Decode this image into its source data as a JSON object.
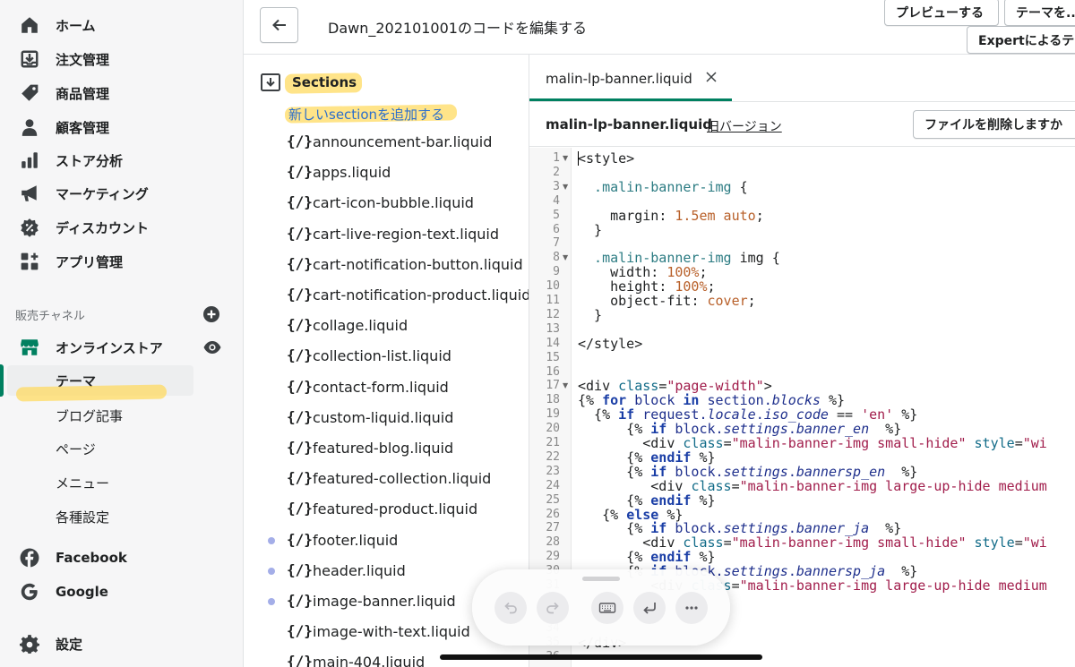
{
  "nav": {
    "items": [
      {
        "label": "ホーム",
        "icon": "home-icon"
      },
      {
        "label": "注文管理",
        "icon": "orders-icon"
      },
      {
        "label": "商品管理",
        "icon": "tag-icon"
      },
      {
        "label": "顧客管理",
        "icon": "person-icon"
      },
      {
        "label": "ストア分析",
        "icon": "bar-chart-icon"
      },
      {
        "label": "マーケティング",
        "icon": "megaphone-icon"
      },
      {
        "label": "ディスカウント",
        "icon": "discount-icon"
      },
      {
        "label": "アプリ管理",
        "icon": "apps-icon"
      }
    ],
    "channels_heading": "販売チャネル",
    "online_store": {
      "label": "オンラインストア",
      "icon": "store-icon"
    },
    "online_store_sub": [
      {
        "label": "テーマ",
        "active": true
      },
      {
        "label": "ブログ記事"
      },
      {
        "label": "ページ"
      },
      {
        "label": "メニュー"
      },
      {
        "label": "各種設定"
      }
    ],
    "apps": [
      {
        "label": "Facebook",
        "icon": "facebook-icon"
      },
      {
        "label": "Google",
        "icon": "google-icon"
      }
    ],
    "settings_label": "設定"
  },
  "topbar": {
    "title": "Dawn_202101001のコードを編集する",
    "preview_label": "プレビューする",
    "theme_label": "テーマを...",
    "expert_label": "Expertによるテ..."
  },
  "tree": {
    "folder_label": "Sections",
    "add_new_label": "新しいsectionを追加する",
    "code_glyph": "{/}",
    "files": [
      {
        "name": "announcement-bar.liquid",
        "modified": false
      },
      {
        "name": "apps.liquid",
        "modified": false
      },
      {
        "name": "cart-icon-bubble.liquid",
        "modified": false
      },
      {
        "name": "cart-live-region-text.liquid",
        "modified": false
      },
      {
        "name": "cart-notification-button.liquid",
        "modified": false
      },
      {
        "name": "cart-notification-product.liquid",
        "modified": false
      },
      {
        "name": "collage.liquid",
        "modified": false
      },
      {
        "name": "collection-list.liquid",
        "modified": false
      },
      {
        "name": "contact-form.liquid",
        "modified": false
      },
      {
        "name": "custom-liquid.liquid",
        "modified": false
      },
      {
        "name": "featured-blog.liquid",
        "modified": false
      },
      {
        "name": "featured-collection.liquid",
        "modified": false
      },
      {
        "name": "featured-product.liquid",
        "modified": false
      },
      {
        "name": "footer.liquid",
        "modified": true
      },
      {
        "name": "header.liquid",
        "modified": true
      },
      {
        "name": "image-banner.liquid",
        "modified": true
      },
      {
        "name": "image-with-text.liquid",
        "modified": false
      },
      {
        "name": "main-404.liquid",
        "modified": false
      }
    ]
  },
  "editor": {
    "tab_label": "malin-lp-banner.liquid",
    "file_title": "malin-lp-banner.liquid",
    "old_version_label": "旧バージョン",
    "delete_label": "ファイルを削除しますか",
    "line_numbers": [
      "1",
      "2",
      "3",
      "4",
      "5",
      "6",
      "7",
      "8",
      "9",
      "10",
      "11",
      "12",
      "13",
      "14",
      "15",
      "16",
      "17",
      "18",
      "19",
      "20",
      "21",
      "22",
      "23",
      "24",
      "25",
      "26",
      "27",
      "28",
      "29",
      "30",
      "31",
      "32",
      "33",
      "34",
      "35",
      "36"
    ],
    "fold_lines": [
      "1",
      "3",
      "8",
      "17"
    ],
    "lines": [
      [
        {
          "t": "<style>",
          "c": "t"
        }
      ],
      [],
      [
        {
          "t": "  .malin-banner-img",
          "c": "s"
        },
        {
          "t": " {",
          "c": "p"
        }
      ],
      [],
      [
        {
          "t": "    margin",
          "c": "p"
        },
        {
          "t": ": ",
          "c": "p"
        },
        {
          "t": "1.5em auto",
          "c": "v"
        },
        {
          "t": ";",
          "c": "p"
        }
      ],
      [
        {
          "t": "  }",
          "c": "p"
        }
      ],
      [],
      [
        {
          "t": "  .malin-banner-img",
          "c": "s"
        },
        {
          "t": " img {",
          "c": "p"
        }
      ],
      [
        {
          "t": "    width",
          "c": "p"
        },
        {
          "t": ": ",
          "c": "p"
        },
        {
          "t": "100%",
          "c": "v"
        },
        {
          "t": ";",
          "c": "p"
        }
      ],
      [
        {
          "t": "    height",
          "c": "p"
        },
        {
          "t": ": ",
          "c": "p"
        },
        {
          "t": "100%",
          "c": "v"
        },
        {
          "t": ";",
          "c": "p"
        }
      ],
      [
        {
          "t": "    object-fit",
          "c": "p"
        },
        {
          "t": ": ",
          "c": "p"
        },
        {
          "t": "cover",
          "c": "v"
        },
        {
          "t": ";",
          "c": "p"
        }
      ],
      [
        {
          "t": "  }",
          "c": "p"
        }
      ],
      [],
      [
        {
          "t": "</style>",
          "c": "t"
        }
      ],
      [],
      [],
      [
        {
          "t": "<div ",
          "c": "t"
        },
        {
          "t": "class",
          "c": "a"
        },
        {
          "t": "=",
          "c": "p"
        },
        {
          "t": "\"page-width\"",
          "c": "str"
        },
        {
          "t": ">",
          "c": "t"
        }
      ],
      [
        {
          "t": "{% ",
          "c": "lq"
        },
        {
          "t": "for",
          "c": "kw"
        },
        {
          "t": " block ",
          "c": "vr"
        },
        {
          "t": "in",
          "c": "kw"
        },
        {
          "t": " section.",
          "c": "vr"
        },
        {
          "t": "blocks",
          "c": "it"
        },
        {
          "t": " %}",
          "c": "lq"
        }
      ],
      [
        {
          "t": "  {% ",
          "c": "lq"
        },
        {
          "t": "if",
          "c": "kw"
        },
        {
          "t": " request.",
          "c": "vr"
        },
        {
          "t": "locale",
          "c": "it"
        },
        {
          "t": ".",
          "c": "vr"
        },
        {
          "t": "iso_code",
          "c": "it"
        },
        {
          "t": " == ",
          "c": "p"
        },
        {
          "t": "'en'",
          "c": "str"
        },
        {
          "t": " %}",
          "c": "lq"
        }
      ],
      [
        {
          "t": "      {% ",
          "c": "lq"
        },
        {
          "t": "if",
          "c": "kw"
        },
        {
          "t": " block.",
          "c": "vr"
        },
        {
          "t": "settings",
          "c": "it"
        },
        {
          "t": ".",
          "c": "vr"
        },
        {
          "t": "banner_en",
          "c": "it"
        },
        {
          "t": "  %}",
          "c": "lq"
        }
      ],
      [
        {
          "t": "        <div ",
          "c": "t"
        },
        {
          "t": "class",
          "c": "a"
        },
        {
          "t": "=",
          "c": "p"
        },
        {
          "t": "\"malin-banner-img small-hide\"",
          "c": "str"
        },
        {
          "t": " style",
          "c": "a"
        },
        {
          "t": "=",
          "c": "p"
        },
        {
          "t": "\"wi",
          "c": "str"
        }
      ],
      [
        {
          "t": "      {% ",
          "c": "lq"
        },
        {
          "t": "endif",
          "c": "kw"
        },
        {
          "t": " %}",
          "c": "lq"
        }
      ],
      [
        {
          "t": "      {% ",
          "c": "lq"
        },
        {
          "t": "if",
          "c": "kw"
        },
        {
          "t": " block.",
          "c": "vr"
        },
        {
          "t": "settings",
          "c": "it"
        },
        {
          "t": ".",
          "c": "vr"
        },
        {
          "t": "bannersp_en",
          "c": "it"
        },
        {
          "t": "  %}",
          "c": "lq"
        }
      ],
      [
        {
          "t": "         <div ",
          "c": "t"
        },
        {
          "t": "class",
          "c": "a"
        },
        {
          "t": "=",
          "c": "p"
        },
        {
          "t": "\"malin-banner-img large-up-hide medium",
          "c": "str"
        }
      ],
      [
        {
          "t": "      {% ",
          "c": "lq"
        },
        {
          "t": "endif",
          "c": "kw"
        },
        {
          "t": " %}",
          "c": "lq"
        }
      ],
      [
        {
          "t": "   {% ",
          "c": "lq"
        },
        {
          "t": "else",
          "c": "kw"
        },
        {
          "t": " %}",
          "c": "lq"
        }
      ],
      [
        {
          "t": "      {% ",
          "c": "lq"
        },
        {
          "t": "if",
          "c": "kw"
        },
        {
          "t": " block.",
          "c": "vr"
        },
        {
          "t": "settings",
          "c": "it"
        },
        {
          "t": ".",
          "c": "vr"
        },
        {
          "t": "banner_ja",
          "c": "it"
        },
        {
          "t": "  %}",
          "c": "lq"
        }
      ],
      [
        {
          "t": "        <div ",
          "c": "t"
        },
        {
          "t": "class",
          "c": "a"
        },
        {
          "t": "=",
          "c": "p"
        },
        {
          "t": "\"malin-banner-img small-hide\"",
          "c": "str"
        },
        {
          "t": " style",
          "c": "a"
        },
        {
          "t": "=",
          "c": "p"
        },
        {
          "t": "\"wi",
          "c": "str"
        }
      ],
      [
        {
          "t": "      {% ",
          "c": "lq"
        },
        {
          "t": "endif",
          "c": "kw"
        },
        {
          "t": " %}",
          "c": "lq"
        }
      ],
      [
        {
          "t": "      {% ",
          "c": "lq"
        },
        {
          "t": "if",
          "c": "kw"
        },
        {
          "t": " block.",
          "c": "vr"
        },
        {
          "t": "settings",
          "c": "it"
        },
        {
          "t": ".",
          "c": "vr"
        },
        {
          "t": "bannersp_ja",
          "c": "it"
        },
        {
          "t": "  %}",
          "c": "lq"
        }
      ],
      [
        {
          "t": "         <div ",
          "c": "t"
        },
        {
          "t": "class",
          "c": "a"
        },
        {
          "t": "=",
          "c": "p"
        },
        {
          "t": "\"malin-banner-img large-up-hide medium",
          "c": "str"
        }
      ],
      [],
      [],
      [],
      [
        {
          "t": "</div>",
          "c": "t"
        }
      ],
      []
    ]
  },
  "toolbar": {
    "buttons": [
      {
        "icon": "undo-icon"
      },
      {
        "icon": "redo-icon"
      },
      {
        "icon": "keyboard-icon"
      },
      {
        "icon": "return-icon"
      },
      {
        "icon": "more-icon"
      }
    ]
  },
  "colors": {
    "accent": "#008060",
    "link": "#2c6ecb",
    "highlight": "#ffda5c",
    "modified_dot": "#a4aee8"
  }
}
